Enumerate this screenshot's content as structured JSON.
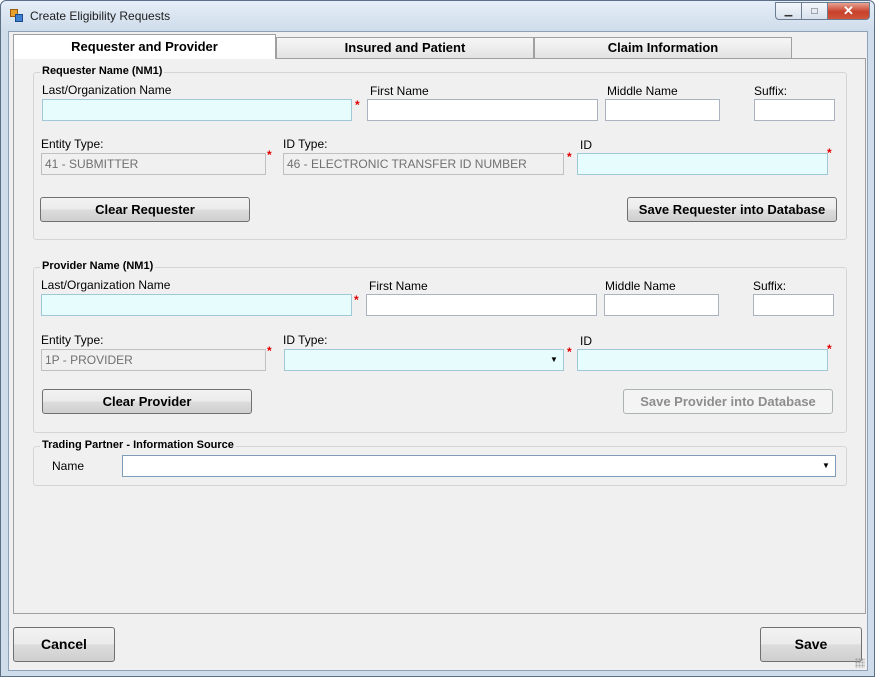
{
  "window": {
    "title": "Create Eligibility Requests",
    "controls": {
      "minimize": "▁",
      "maximize": "□",
      "close": "✕"
    }
  },
  "tabs": [
    {
      "label": "Requester and Provider",
      "active": true
    },
    {
      "label": "Insured and Patient",
      "active": false
    },
    {
      "label": "Claim Information",
      "active": false
    }
  ],
  "requester": {
    "group_title": "Requester Name (NM1)",
    "last_name_label": "Last/Organization Name",
    "last_name_value": "",
    "first_name_label": "First Name",
    "first_name_value": "",
    "middle_name_label": "Middle Name",
    "middle_name_value": "",
    "suffix_label": "Suffix:",
    "suffix_value": "",
    "entity_type_label": "Entity Type:",
    "entity_type_value": "41 - SUBMITTER",
    "id_type_label": "ID Type:",
    "id_type_value": "46 - ELECTRONIC TRANSFER ID NUMBER",
    "id_label": "ID",
    "id_value": "",
    "clear_button": "Clear Requester",
    "save_button": "Save Requester into Database"
  },
  "provider": {
    "group_title": "Provider Name (NM1)",
    "last_name_label": "Last/Organization Name",
    "last_name_value": "",
    "first_name_label": "First Name",
    "first_name_value": "",
    "middle_name_label": "Middle Name",
    "middle_name_value": "",
    "suffix_label": "Suffix:",
    "suffix_value": "",
    "entity_type_label": "Entity Type:",
    "entity_type_value": "1P - PROVIDER",
    "id_type_label": "ID Type:",
    "id_type_value": "",
    "id_label": "ID",
    "id_value": "",
    "clear_button": "Clear Provider",
    "save_button": "Save Provider into Database"
  },
  "trading_partner": {
    "group_title": "Trading Partner - Information Source",
    "name_label": "Name",
    "name_value": ""
  },
  "footer": {
    "cancel_button": "Cancel",
    "save_button": "Save"
  },
  "required_marker": "*",
  "colors": {
    "required_field_bg": "#e7fdfd",
    "required_marker": "#e00000",
    "window_frame": "#cfdcea"
  }
}
